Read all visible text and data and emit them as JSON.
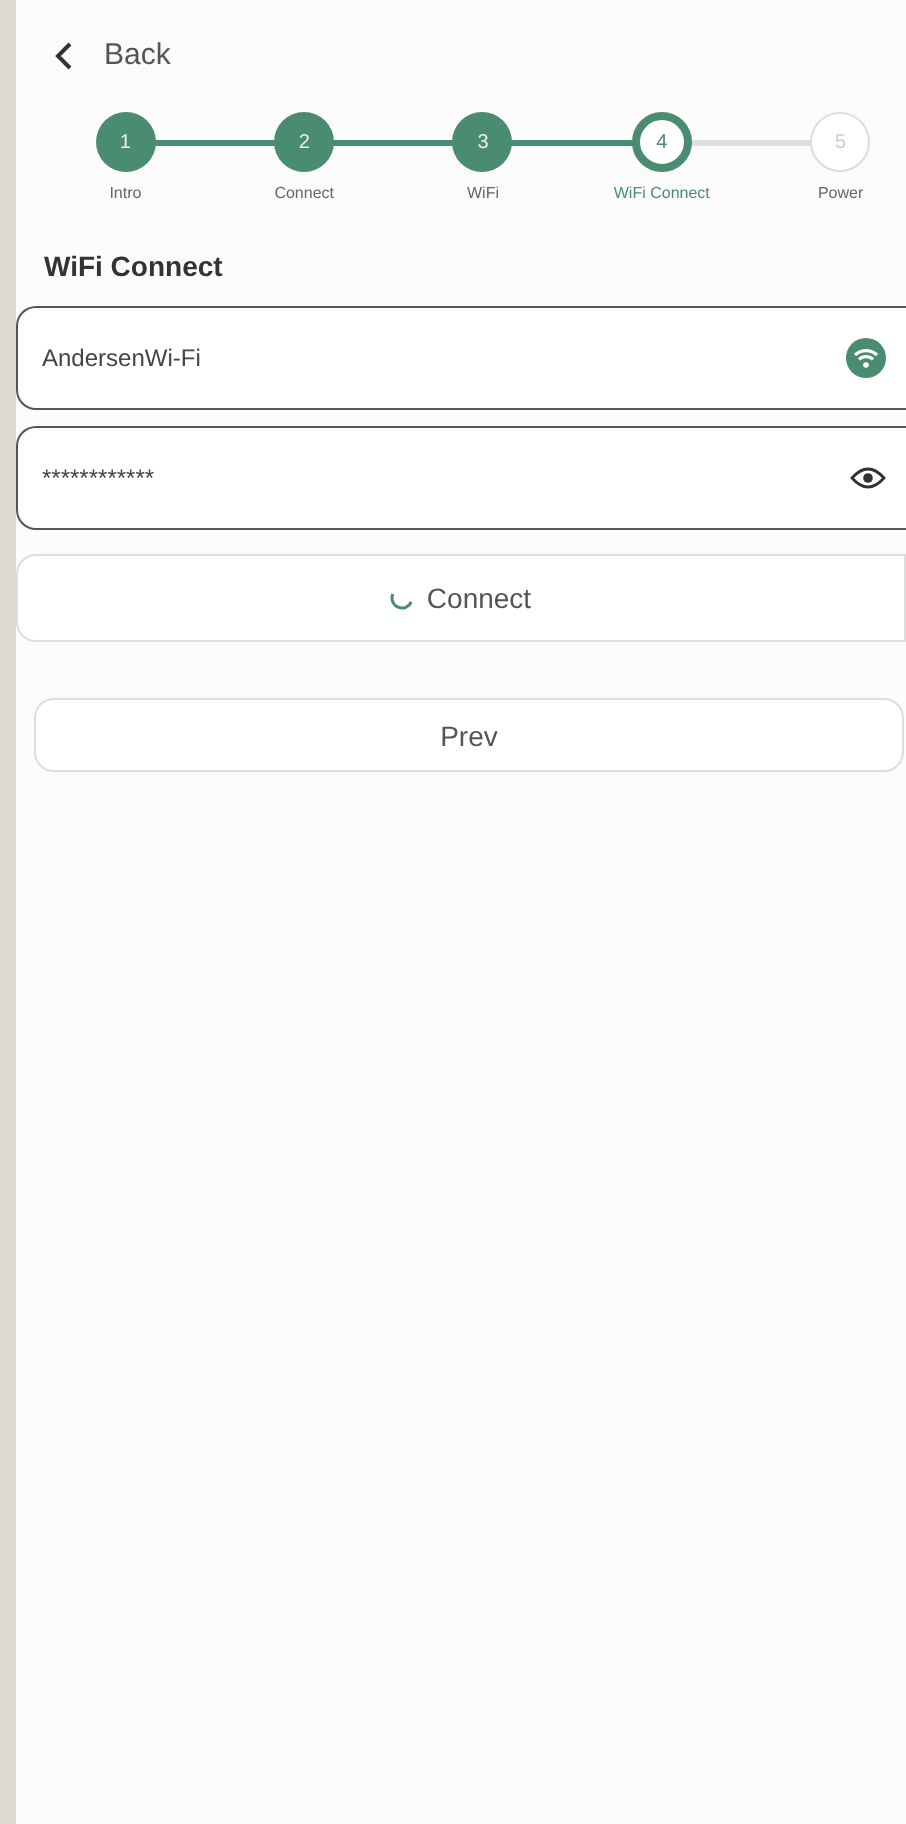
{
  "back": {
    "label": "Back"
  },
  "steps": [
    {
      "number": "1",
      "label": "Intro",
      "completed": true,
      "selected": false
    },
    {
      "number": "2",
      "label": "Connect",
      "completed": true,
      "selected": false
    },
    {
      "number": "3",
      "label": "WiFi",
      "completed": true,
      "selected": false
    },
    {
      "number": "4",
      "label": "WiFi Connect",
      "completed": false,
      "selected": true
    },
    {
      "number": "5",
      "label": "Power",
      "completed": false,
      "selected": false
    }
  ],
  "title": "WiFi Connect",
  "fields": [
    {
      "kind": "network",
      "value": "AndersenWi-Fi"
    },
    {
      "kind": "password",
      "value": "************"
    }
  ],
  "buttons": [
    {
      "label": "Connect",
      "loading": true,
      "kind": "wide"
    },
    {
      "label": "Prev",
      "loading": false,
      "kind": "inset"
    }
  ]
}
